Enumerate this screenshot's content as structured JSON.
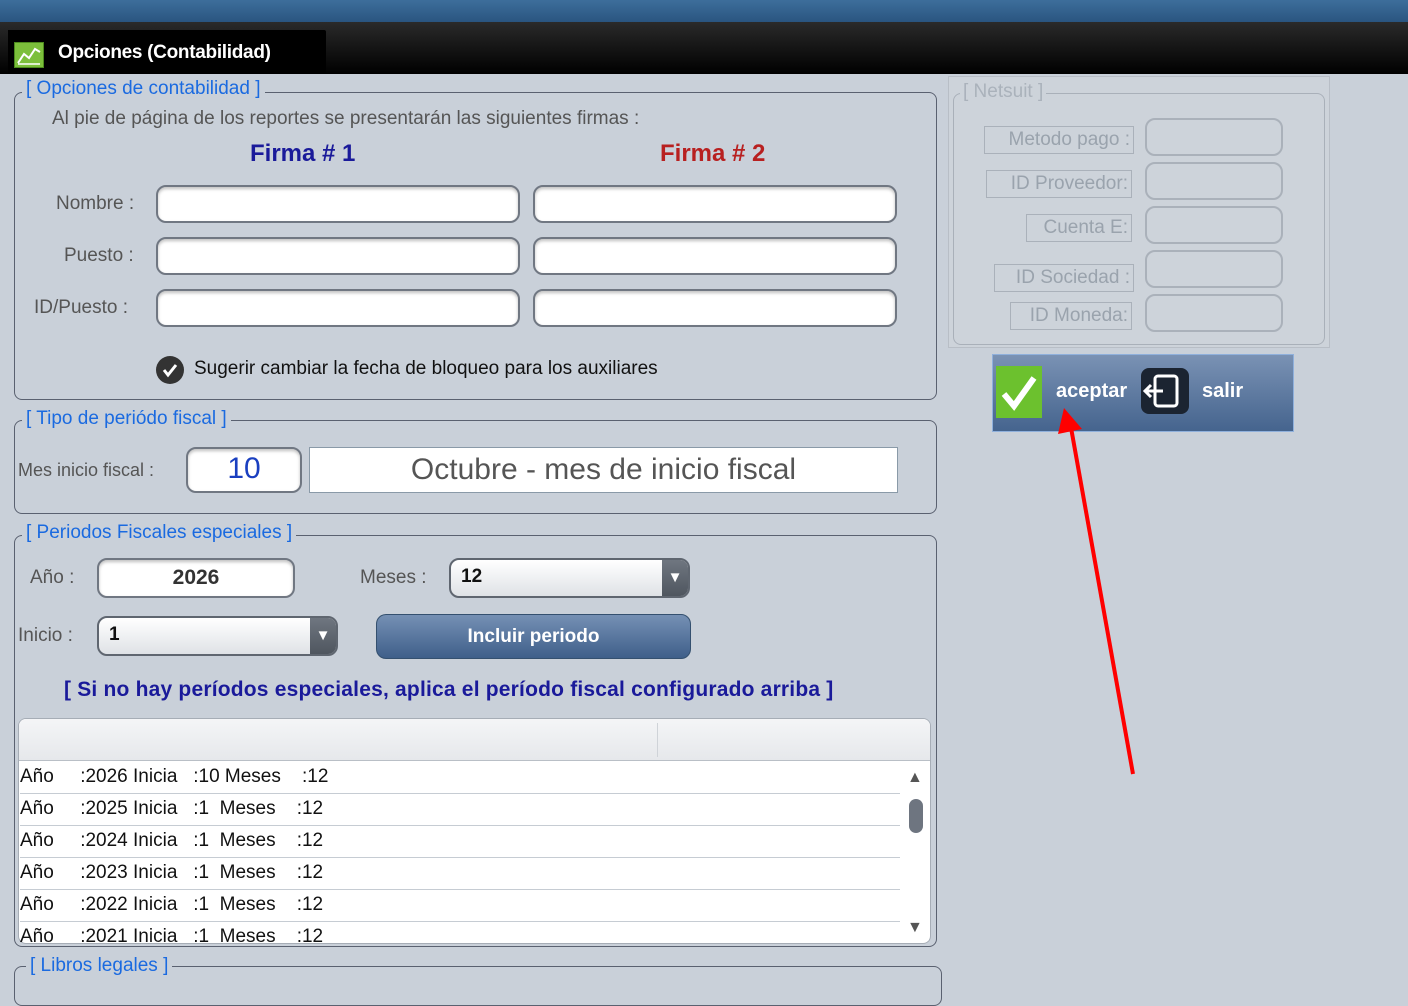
{
  "window": {
    "title": "Opciones (Contabilidad)"
  },
  "accounting_options": {
    "legend": "[ Opciones de contabilidad ]",
    "description": "Al pie de página de los reportes se presentarán las siguientes firmas :",
    "firma1_heading": "Firma # 1",
    "firma2_heading": "Firma # 2",
    "nombre_label": "Nombre :",
    "puesto_label": "Puesto :",
    "idpuesto_label": "ID/Puesto :",
    "firma1": {
      "nombre": "",
      "puesto": "",
      "idpuesto": ""
    },
    "firma2": {
      "nombre": "",
      "puesto": "",
      "idpuesto": ""
    },
    "suggest_checkbox_label": "Sugerir cambiar la fecha de bloqueo para los auxiliares",
    "suggest_checked": true,
    "firma1_color": "#1a1a9a",
    "firma2_color": "#b82020"
  },
  "fiscal_period_type": {
    "legend": "[ Tipo de periódo fiscal ]",
    "start_month_label": "Mes inicio fiscal :",
    "start_month_value": "10",
    "start_month_description": "Octubre - mes de inicio fiscal"
  },
  "special_periods": {
    "legend": "[ Periodos Fiscales especiales ]",
    "year_label": "Año :",
    "year_value": "2026",
    "months_label": "Meses :",
    "months_value": "12",
    "start_label": "Inicio :",
    "start_value": "1",
    "include_button": "Incluir periodo",
    "note": "[ Si no hay períodos especiales, aplica el período fiscal configurado arriba ]",
    "rows": [
      "Año     :2026 Inicia   :10 Meses    :12",
      "Año     :2025 Inicia   :1  Meses    :12",
      "Año     :2024 Inicia   :1  Meses    :12",
      "Año     :2023 Inicia   :1  Meses    :12",
      "Año     :2022 Inicia   :1  Meses    :12",
      "Año     :2021 Inicia   :1  Meses    :12"
    ]
  },
  "legal_books": {
    "legend": "[ Libros legales ]"
  },
  "netsuit": {
    "legend": "[ Netsuit ]",
    "metodo_pago_label": "Metodo pago :",
    "id_proveedor_label": "ID Proveedor:",
    "cuenta_e_label": "Cuenta E:",
    "id_sociedad_label": "ID Sociedad :",
    "id_moneda_label": "ID Moneda:"
  },
  "actions": {
    "accept_label": "aceptar",
    "exit_label": "salir"
  },
  "colors": {
    "accent": "#1a6ae0",
    "accept_green": "#6cc12e",
    "annotation_arrow": "#ff0000"
  }
}
